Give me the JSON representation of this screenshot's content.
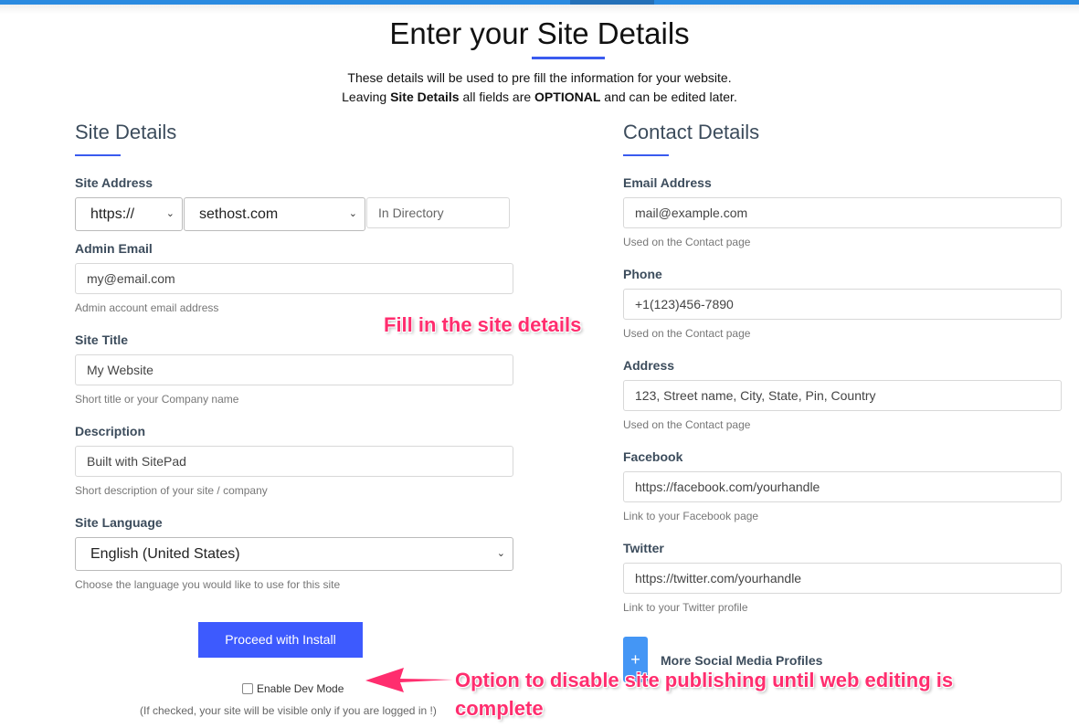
{
  "page": {
    "title": "Enter your Site Details",
    "intro_line1": "These details will be used to pre fill the information for your website.",
    "intro_pre": "Leaving ",
    "intro_bold1": "Site Details",
    "intro_mid": " all fields are ",
    "intro_bold2": "OPTIONAL",
    "intro_post": " and can be edited later."
  },
  "site": {
    "heading": "Site Details",
    "address_label": "Site Address",
    "protocol": "https://",
    "domain": "sethost.com",
    "directory_placeholder": "In Directory",
    "admin_email_label": "Admin Email",
    "admin_email": "my@email.com",
    "admin_email_help": "Admin account email address",
    "title_label": "Site Title",
    "title": "My Website",
    "title_help": "Short title or your Company name",
    "desc_label": "Description",
    "desc": "Built with SitePad",
    "desc_help": "Short description of your site / company",
    "lang_label": "Site Language",
    "lang": "English (United States)",
    "lang_help": "Choose the language you would like to use for this site",
    "proceed": "Proceed with Install",
    "devmode": "Enable Dev Mode",
    "devmode_help": "(If checked, your site will be visible only if you are logged in !)",
    "devmode_checked": false
  },
  "contact": {
    "heading": "Contact Details",
    "email_label": "Email Address",
    "email": "mail@example.com",
    "email_help": "Used on the Contact page",
    "phone_label": "Phone",
    "phone": "+1(123)456-7890",
    "phone_help": "Used on the Contact page",
    "address_label": "Address",
    "address": "123, Street name, City, State, Pin, Country",
    "address_help": "Used on the Contact page",
    "facebook_label": "Facebook",
    "facebook": "https://facebook.com/yourhandle",
    "facebook_help": "Link to your Facebook page",
    "twitter_label": "Twitter",
    "twitter": "https://twitter.com/yourhandle",
    "twitter_help": "Link to your Twitter profile",
    "more_social": "More Social Media Profiles",
    "plus": "+"
  },
  "annotations": {
    "fill": "Fill in the site details",
    "devmode_line1": "Option to disable site publishing until web editing is",
    "devmode_line2": "complete"
  },
  "colors": {
    "accent": "#3d5afe",
    "annotation": "#ff2d6e",
    "topbar": "#2a8ae0"
  }
}
